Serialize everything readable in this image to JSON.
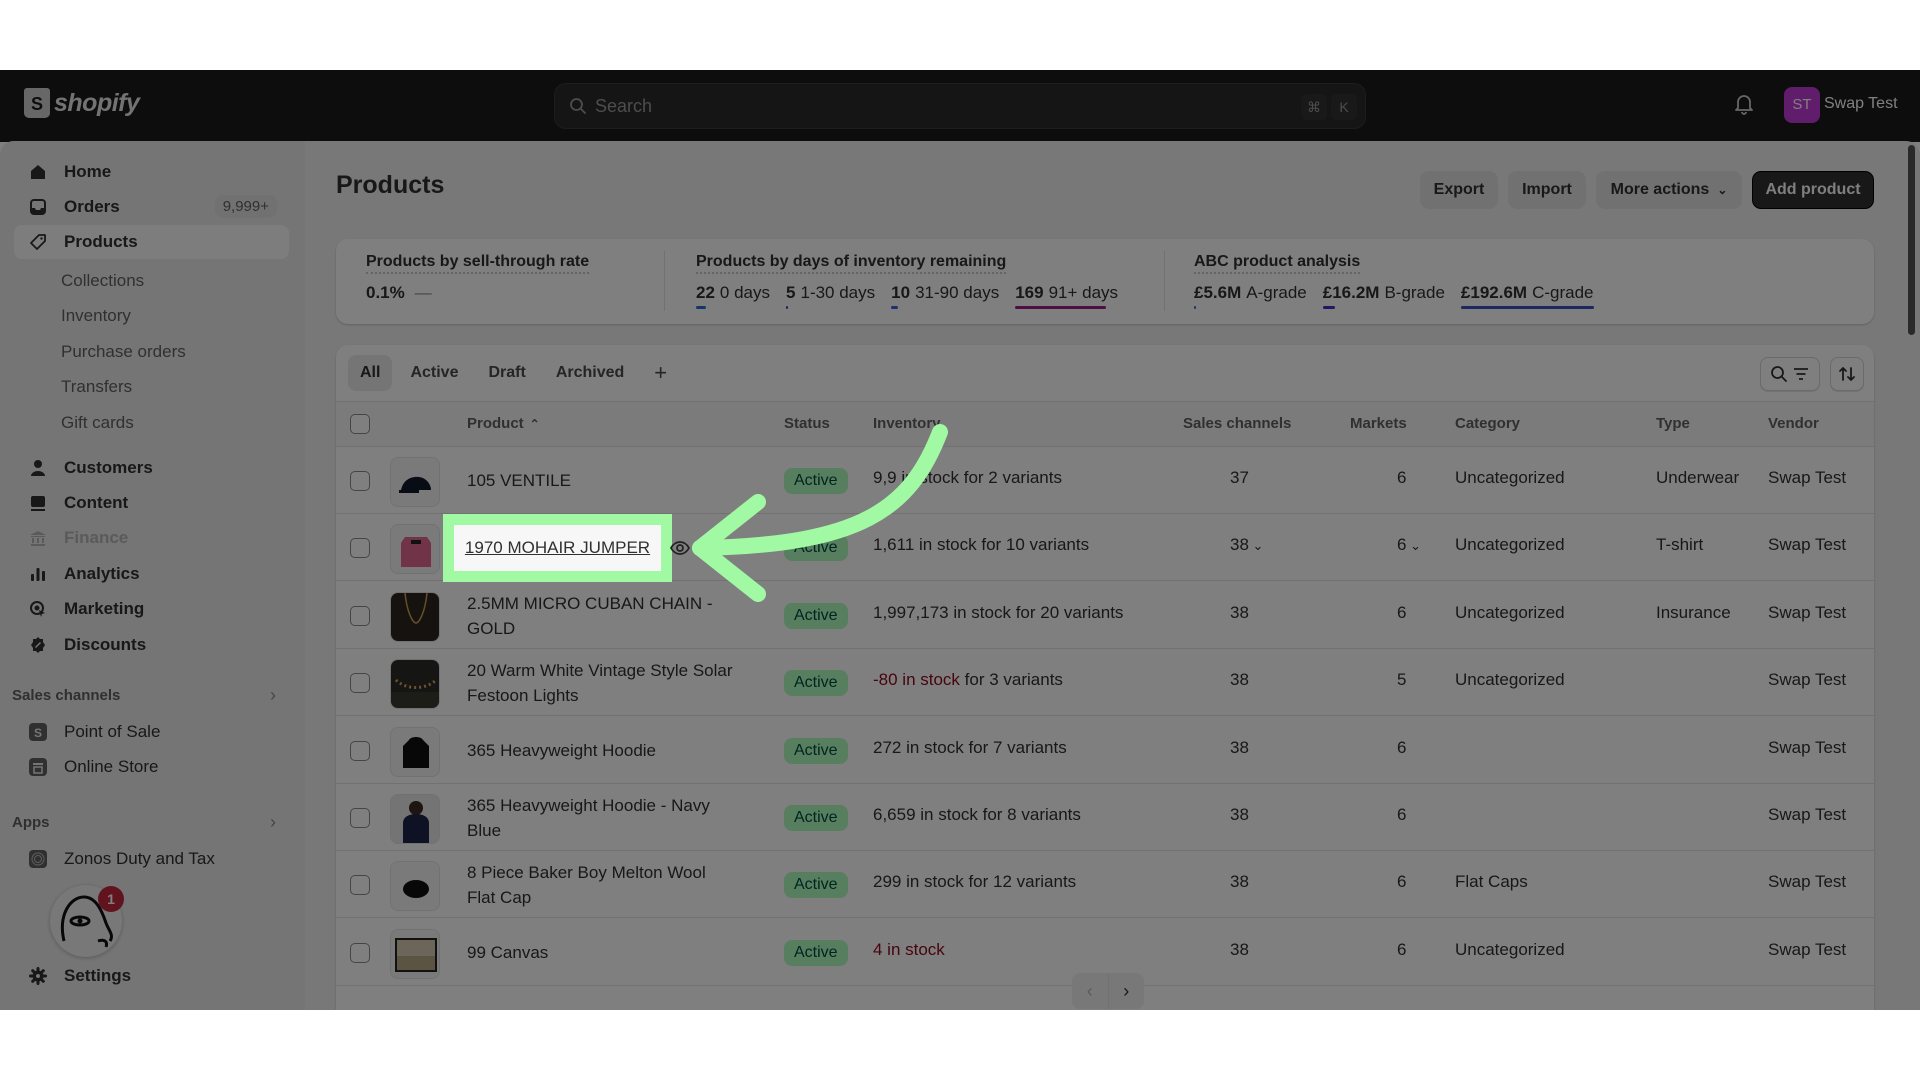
{
  "topbar": {
    "brand": "shopify",
    "brand_glyph": "S",
    "search_placeholder": "Search",
    "shortcut_keys": [
      "⌘",
      "K"
    ],
    "store_initials": "ST",
    "store_name": "Swap Test"
  },
  "sidebar": {
    "items": [
      {
        "label": "Home",
        "icon": "home-icon"
      },
      {
        "label": "Orders",
        "icon": "inbox-icon",
        "badge": "9,999+"
      },
      {
        "label": "Products",
        "icon": "tag-icon",
        "active": true
      },
      {
        "label": "Customers",
        "icon": "person-icon"
      },
      {
        "label": "Content",
        "icon": "image-icon"
      },
      {
        "label": "Finance",
        "icon": "bank-icon",
        "disabled": true
      },
      {
        "label": "Analytics",
        "icon": "bar-chart-icon"
      },
      {
        "label": "Marketing",
        "icon": "target-icon"
      },
      {
        "label": "Discounts",
        "icon": "discount-icon"
      }
    ],
    "product_subitems": [
      "Collections",
      "Inventory",
      "Purchase orders",
      "Transfers",
      "Gift cards"
    ],
    "sales_channels": {
      "label": "Sales channels",
      "items": [
        {
          "label": "Point of Sale",
          "icon": "pos-icon"
        },
        {
          "label": "Online Store",
          "icon": "store-icon"
        }
      ]
    },
    "apps": {
      "label": "Apps",
      "items": [
        {
          "label": "Zonos Duty and Tax",
          "icon": "zonos-icon"
        }
      ]
    },
    "mascot_badge": "1",
    "settings_label": "Settings"
  },
  "page": {
    "title": "Products",
    "actions": {
      "export": "Export",
      "import": "Import",
      "more_actions": "More actions",
      "add_product": "Add product"
    }
  },
  "stats": {
    "sell_through": {
      "title": "Products by sell-through rate",
      "value": "0.1%",
      "trend": "—"
    },
    "days_inventory": {
      "title": "Products by days of inventory remaining",
      "buckets": [
        {
          "count": "22",
          "label": "0 days",
          "color": "#2c6ecb"
        },
        {
          "count": "5",
          "label": "1-30 days",
          "color": "#4b3fd6"
        },
        {
          "count": "10",
          "label": "31-90 days",
          "color": "#3f5fd6"
        },
        {
          "count": "169",
          "label": "91+ days",
          "color": "#9c1f8a"
        }
      ]
    },
    "abc": {
      "title": "ABC product analysis",
      "grades": [
        {
          "value": "£5.6M",
          "label": "A-grade",
          "color": "#2c6ecb"
        },
        {
          "value": "£16.2M",
          "label": "B-grade",
          "color": "#4b2fbf"
        },
        {
          "value": "£192.6M",
          "label": "C-grade",
          "color": "#3b4fc0"
        }
      ]
    }
  },
  "tabs": [
    "All",
    "Active",
    "Draft",
    "Archived"
  ],
  "add_view": "+",
  "table": {
    "columns": [
      "Product",
      "Status",
      "Inventory",
      "Sales channels",
      "Markets",
      "Category",
      "Type",
      "Vendor"
    ],
    "rows": [
      {
        "product": "105 VENTILE",
        "status": "Active",
        "inventory": "9,9",
        "inventory_rest": " in stock for 2 variants",
        "inventory_negative": false,
        "channels": "37",
        "markets": "6",
        "category": "Uncategorized",
        "type": "Underwear",
        "vendor": "Swap Test",
        "thumb": "cap"
      },
      {
        "product": "1970 MOHAIR JUMPER",
        "status": "Active",
        "inventory": "",
        "inventory_rest": "1,611 in stock for 10 variants",
        "inventory_negative": false,
        "channels": "38",
        "markets": "6",
        "category": "Uncategorized",
        "type": "T-shirt",
        "vendor": "Swap Test",
        "thumb": "jumper",
        "dropdowns": true
      },
      {
        "product": "2.5MM MICRO CUBAN CHAIN - GOLD",
        "status": "Active",
        "inventory": "",
        "inventory_rest": "1,997,173 in stock for 20 variants",
        "inventory_negative": false,
        "channels": "38",
        "markets": "6",
        "category": "Uncategorized",
        "type": "Insurance",
        "vendor": "Swap Test",
        "thumb": "chain"
      },
      {
        "product": "20 Warm White Vintage Style Solar Festoon Lights",
        "status": "Active",
        "inventory": "-80 in stock",
        "inventory_rest": " for 3 variants",
        "inventory_negative": true,
        "channels": "38",
        "markets": "5",
        "category": "Uncategorized",
        "type": "",
        "vendor": "Swap Test",
        "thumb": "lights"
      },
      {
        "product": "365 Heavyweight Hoodie",
        "status": "Active",
        "inventory": "",
        "inventory_rest": "272 in stock for 7 variants",
        "inventory_negative": false,
        "channels": "38",
        "markets": "6",
        "category": "",
        "type": "",
        "vendor": "Swap Test",
        "thumb": "hoodie"
      },
      {
        "product": "365 Heavyweight Hoodie - Navy Blue",
        "status": "Active",
        "inventory": "",
        "inventory_rest": "6,659 in stock for 8 variants",
        "inventory_negative": false,
        "channels": "38",
        "markets": "6",
        "category": "",
        "type": "",
        "vendor": "Swap Test",
        "thumb": "person"
      },
      {
        "product": "8 Piece Baker Boy Melton Wool Flat Cap",
        "status": "Active",
        "inventory": "",
        "inventory_rest": "299 in stock for 12 variants",
        "inventory_negative": false,
        "channels": "38",
        "markets": "6",
        "category": "Flat Caps",
        "type": "",
        "vendor": "Swap Test",
        "thumb": "flatcap"
      },
      {
        "product": "99 Canvas",
        "status": "Active",
        "inventory": "4 in stock",
        "inventory_rest": "",
        "inventory_negative": true,
        "channels": "38",
        "markets": "6",
        "category": "Uncategorized",
        "type": "",
        "vendor": "Swap Test",
        "thumb": "canvas"
      }
    ]
  },
  "pagination": {
    "prev": "‹",
    "next": "›"
  },
  "annotation": {
    "highlighted_product": "1970 MOHAIR JUMPER",
    "color": "#a1f9a3"
  }
}
